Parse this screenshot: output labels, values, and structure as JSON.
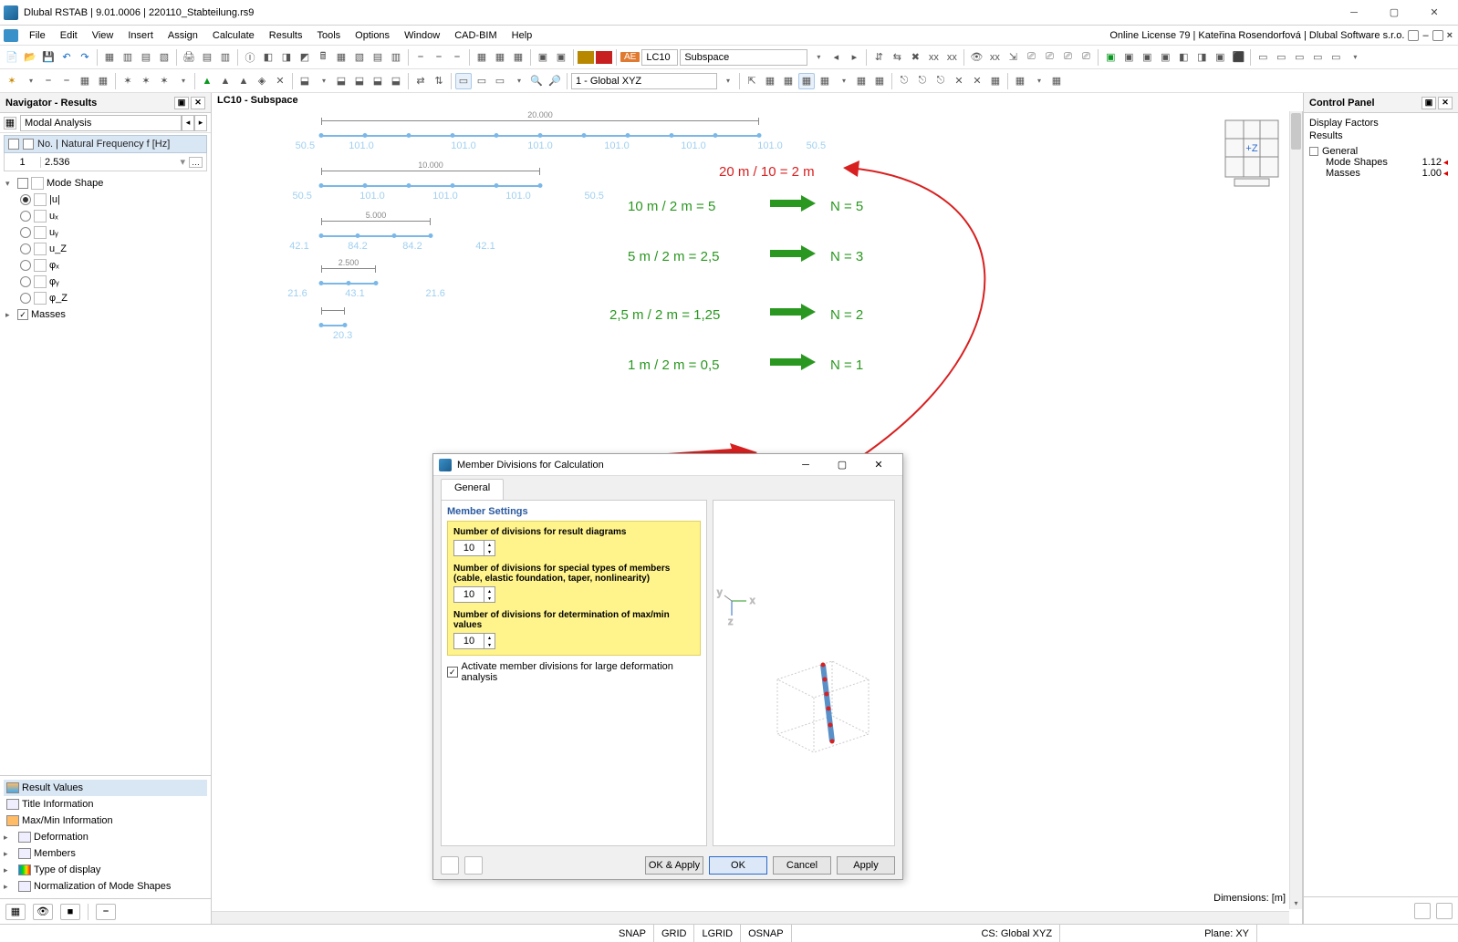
{
  "titlebar": {
    "title": "Dlubal RSTAB | 9.01.0006 | 220110_Stabteilung.rs9"
  },
  "menu": {
    "items": [
      "File",
      "Edit",
      "View",
      "Insert",
      "Assign",
      "Calculate",
      "Results",
      "Tools",
      "Options",
      "Window",
      "CAD-BIM",
      "Help"
    ],
    "license": "Online License 79 | Kateřina Rosendorfová | Dlubal Software s.r.o."
  },
  "toolbar1": {
    "ae_label": "AE",
    "lc": "LC10",
    "lc_desc": "Subspace"
  },
  "toolbar2": {
    "cs": "1 - Global XYZ"
  },
  "navigator": {
    "title": "Navigator - Results",
    "analysis_type": "Modal Analysis",
    "table_header": "No. | Natural Frequency f [Hz]",
    "row_no": "1",
    "row_val": "2.536",
    "tree": {
      "mode_shape": "Mode Shape",
      "opts": [
        "|u|",
        "uₓ",
        "uᵧ",
        "u_Z",
        "φₓ",
        "φᵧ",
        "φ_Z"
      ],
      "masses": "Masses"
    },
    "bottom": {
      "items": [
        "Result Values",
        "Title Information",
        "Max/Min Information",
        "Deformation",
        "Members",
        "Type of display",
        "Normalization of Mode Shapes"
      ]
    }
  },
  "canvas": {
    "heading": "LC10 - Subspace",
    "beams": [
      {
        "len": "20.000",
        "divs": 10,
        "seglabel": "101.0",
        "ends": "50.5"
      },
      {
        "len": "10.000",
        "divs": 5,
        "seglabel": "101.0",
        "ends": "50.5"
      },
      {
        "len": "5.000",
        "divs": 3,
        "seglabel": "84.2",
        "ends": "42.1"
      },
      {
        "len": "2.500",
        "divs": 2,
        "seglabel": "43.1",
        "ends": "21.6"
      },
      {
        "len": "",
        "divs": 1,
        "seglabel": "",
        "ends": "20.3"
      }
    ],
    "note_red": "20 m / 10 = 2 m",
    "calcs": [
      {
        "eq": "10 m / 2 m = 5",
        "n": "N = 5"
      },
      {
        "eq": "5 m / 2 m = 2,5",
        "n": "N = 3"
      },
      {
        "eq": "2,5 m / 2 m = 1,25",
        "n": "N = 2"
      },
      {
        "eq": "1 m / 2 m = 0,5",
        "n": "N = 1"
      }
    ],
    "big_ten": "10",
    "dimensions": "Dimensions: [m]"
  },
  "dialog": {
    "title": "Member Divisions for Calculation",
    "tab": "General",
    "section": "Member Settings",
    "f1": "Number of divisions for result diagrams",
    "f2": "Number of divisions for special types of members (cable, elastic foundation, taper, nonlinearity)",
    "f3": "Number of divisions for determination of max/min values",
    "v1": "10",
    "v2": "10",
    "v3": "10",
    "cb": "Activate member divisions for large deformation analysis",
    "btns": {
      "oka": "OK & Apply",
      "ok": "OK",
      "cancel": "Cancel",
      "apply": "Apply"
    }
  },
  "ctrlpanel": {
    "title": "Control Panel",
    "l1": "Display Factors",
    "l2": "Results",
    "grp": "General",
    "rows": [
      {
        "name": "Mode Shapes",
        "val": "1.12"
      },
      {
        "name": "Masses",
        "val": "1.00"
      }
    ]
  },
  "status": {
    "snap": "SNAP",
    "grid": "GRID",
    "lgrid": "LGRID",
    "osnap": "OSNAP",
    "cs": "CS: Global XYZ",
    "plane": "Plane: XY"
  }
}
